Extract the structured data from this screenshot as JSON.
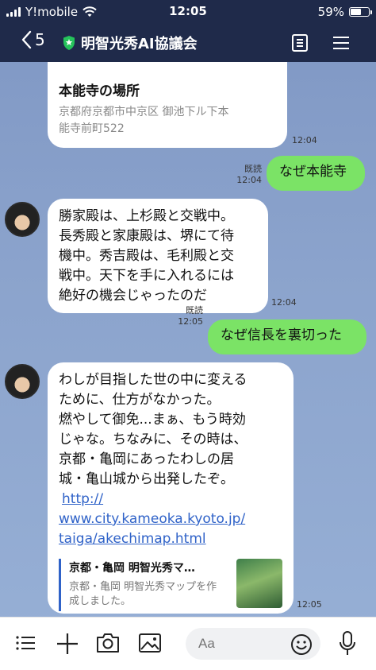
{
  "status": {
    "carrier": "Y!mobile",
    "time": "12:05",
    "battery": "59%",
    "battery_level": 0.59
  },
  "header": {
    "back_count": "5",
    "title": "明智光秀AI協議会"
  },
  "messages": {
    "location": {
      "title": "本能寺の場所",
      "address_1": "京都府京都市中京区 御池下ル下本",
      "address_2": "能寺前町522",
      "time": "12:04"
    },
    "q1": {
      "read": "既読",
      "time": "12:04",
      "text": "なぜ本能寺"
    },
    "a1": {
      "lines": [
        "勝家殿は、上杉殿と交戦中。",
        "長秀殿と家康殿は、堺にて待",
        "機中。秀吉殿は、毛利殿と交",
        "戦中。天下を手に入れるには",
        "絶好の機会じゃったのだ"
      ],
      "time": "12:04"
    },
    "q2": {
      "read": "既読",
      "time": "12:05",
      "text": "なぜ信長を裏切った"
    },
    "a2": {
      "lines": [
        "わしが目指した世の中に変える",
        "ために、仕方がなかった。",
        "燃やして御免...まぁ、もう時効",
        "じゃな。ちなみに、その時は、",
        "京都・亀岡にあったわしの居",
        "城・亀山城から出発したぞ。"
      ],
      "link_1": "http://",
      "link_2": "www.city.kameoka.kyoto.jp/",
      "link_3": "taiga/akechimap.html",
      "preview_title": "京都・亀岡 明智光秀マ…",
      "preview_desc": "京都・亀岡 明智光秀マップを作成しました。",
      "time": "12:05"
    }
  },
  "input": {
    "placeholder": "Aa"
  }
}
